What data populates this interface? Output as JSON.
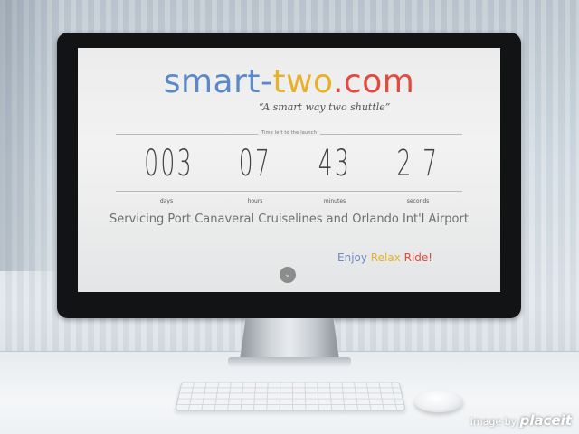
{
  "site": {
    "title_parts": [
      "smart-",
      "two",
      ".com"
    ],
    "tagline": "“A smart way two shuttle”",
    "launch_label": "Time left to the launch"
  },
  "countdown": [
    {
      "value": "003",
      "label": "days"
    },
    {
      "value": "07",
      "label": "hours"
    },
    {
      "value": "43",
      "label": "minutes"
    },
    {
      "value": "2 7",
      "label": "seconds"
    }
  ],
  "service_text": "Servicing Port Canaveral Cruiselines and Orlando Int'l Airport",
  "enjoy": {
    "w1": "Enjoy",
    "w2": "Relax",
    "w3": "Ride!"
  },
  "scroll_button_icon": "chevron-down-icon",
  "credit": {
    "prefix": "Image by",
    "brand": "placeit"
  },
  "colors": {
    "blue": "#5b89c8",
    "yellow": "#e6b22a",
    "red": "#e04a3f"
  }
}
